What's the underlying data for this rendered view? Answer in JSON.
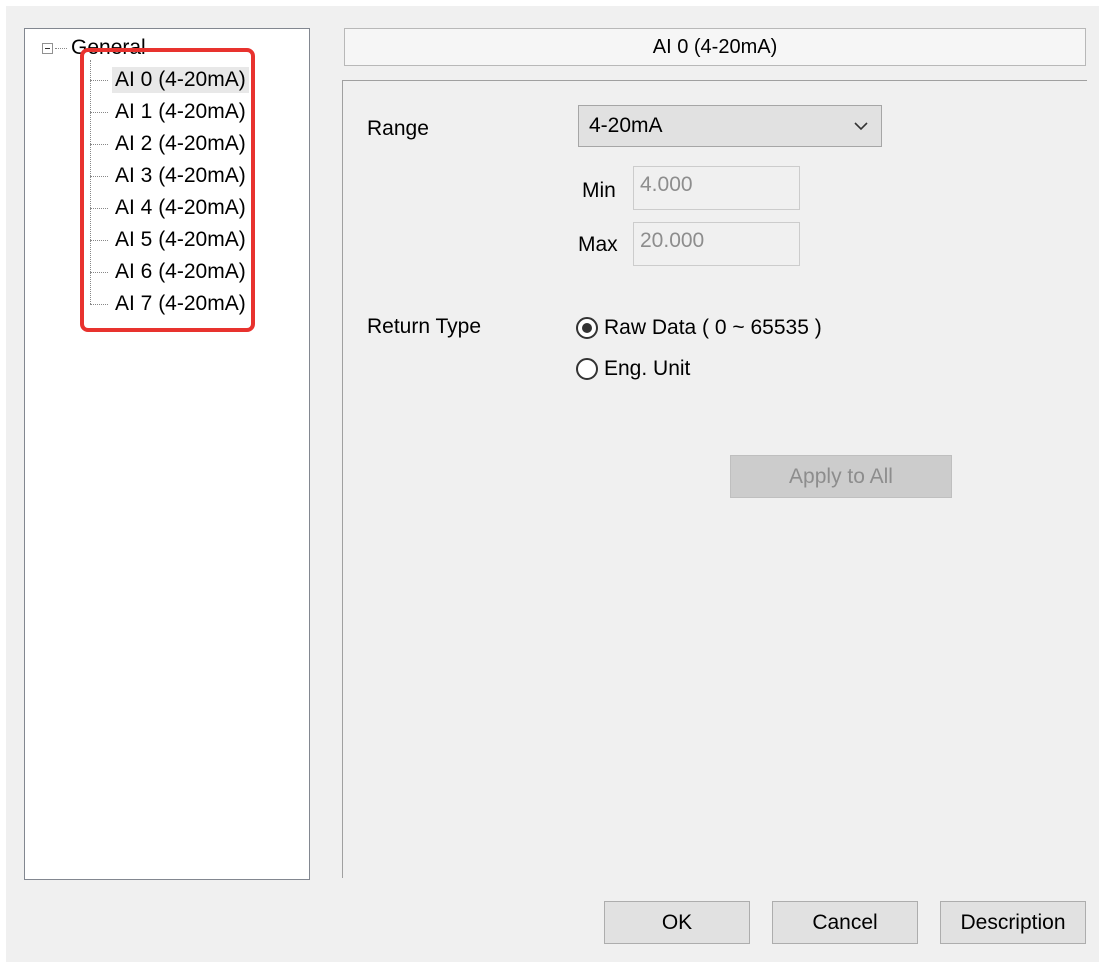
{
  "tree": {
    "root_label": "General",
    "items": [
      {
        "label": "AI 0 (4-20mA)"
      },
      {
        "label": "AI 1 (4-20mA)"
      },
      {
        "label": "AI 2 (4-20mA)"
      },
      {
        "label": "AI 3 (4-20mA)"
      },
      {
        "label": "AI 4 (4-20mA)"
      },
      {
        "label": "AI 5 (4-20mA)"
      },
      {
        "label": "AI 6 (4-20mA)"
      },
      {
        "label": "AI 7 (4-20mA)"
      }
    ],
    "selected_index": 0
  },
  "header": {
    "title": "AI 0 (4-20mA)"
  },
  "form": {
    "range_label": "Range",
    "range_value": "4-20mA",
    "min_label": "Min",
    "min_value": "4.000",
    "max_label": "Max",
    "max_value": "20.000",
    "return_type_label": "Return Type",
    "return_options": [
      {
        "label": "Raw Data ( 0 ~ 65535 )",
        "checked": true
      },
      {
        "label": "Eng. Unit",
        "checked": false
      }
    ],
    "apply_all_label": "Apply to All"
  },
  "footer": {
    "ok_label": "OK",
    "cancel_label": "Cancel",
    "description_label": "Description"
  },
  "colors": {
    "highlight": "#e8322e",
    "dialog_bg": "#f0f0f0",
    "disabled_text": "#8d8d8d"
  }
}
